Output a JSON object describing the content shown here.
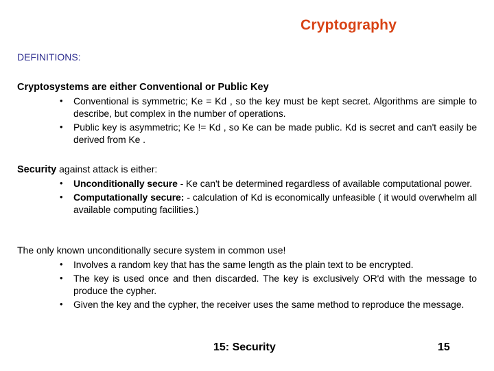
{
  "slide": {
    "title": "Cryptography",
    "section_label": "DEFINITIONS:",
    "sections": [
      {
        "heading_bold": "Cryptosystems are either Conventional or Public Key",
        "heading_rest": "",
        "bullets": [
          {
            "bold": "",
            "text": "Conventional is symmetric; Ke  = Kd , so the key must be kept secret. Algorithms are simple to describe, but complex in the number of operations."
          },
          {
            "bold": "",
            "text": "Public key is asymmetric; Ke  != Kd , so Ke  can be made public. Kd  is secret and can't easily be derived from Ke ."
          }
        ]
      },
      {
        "heading_bold": "Security",
        "heading_rest": " against attack is either:",
        "bullets": [
          {
            "bold": "Unconditionally secure",
            "text": " - Ke   can't be determined regardless of available computational power."
          },
          {
            "bold": "Computationally secure:",
            "text": " - calculation of Kd  is economically unfeasible ( it would overwhelm all available computing facilities.)"
          }
        ]
      },
      {
        "heading_bold": "",
        "heading_rest": "The only known unconditionally secure system in common use!",
        "bullets": [
          {
            "bold": "",
            "text": "Involves a random key that has the same length as the plain text to be encrypted."
          },
          {
            "bold": "",
            "text": "The key is used once and then discarded. The key is exclusively OR'd with the message to produce the cypher."
          },
          {
            "bold": "",
            "text": "Given the key and the cypher, the receiver uses the same method to reproduce the message."
          }
        ]
      }
    ],
    "bullet_glyph": "•",
    "footer_label": "15: Security",
    "page_number": "15"
  },
  "colors": {
    "title": "#d84315",
    "section_label": "#2d2d8f",
    "text": "#000000",
    "background": "#ffffff"
  }
}
